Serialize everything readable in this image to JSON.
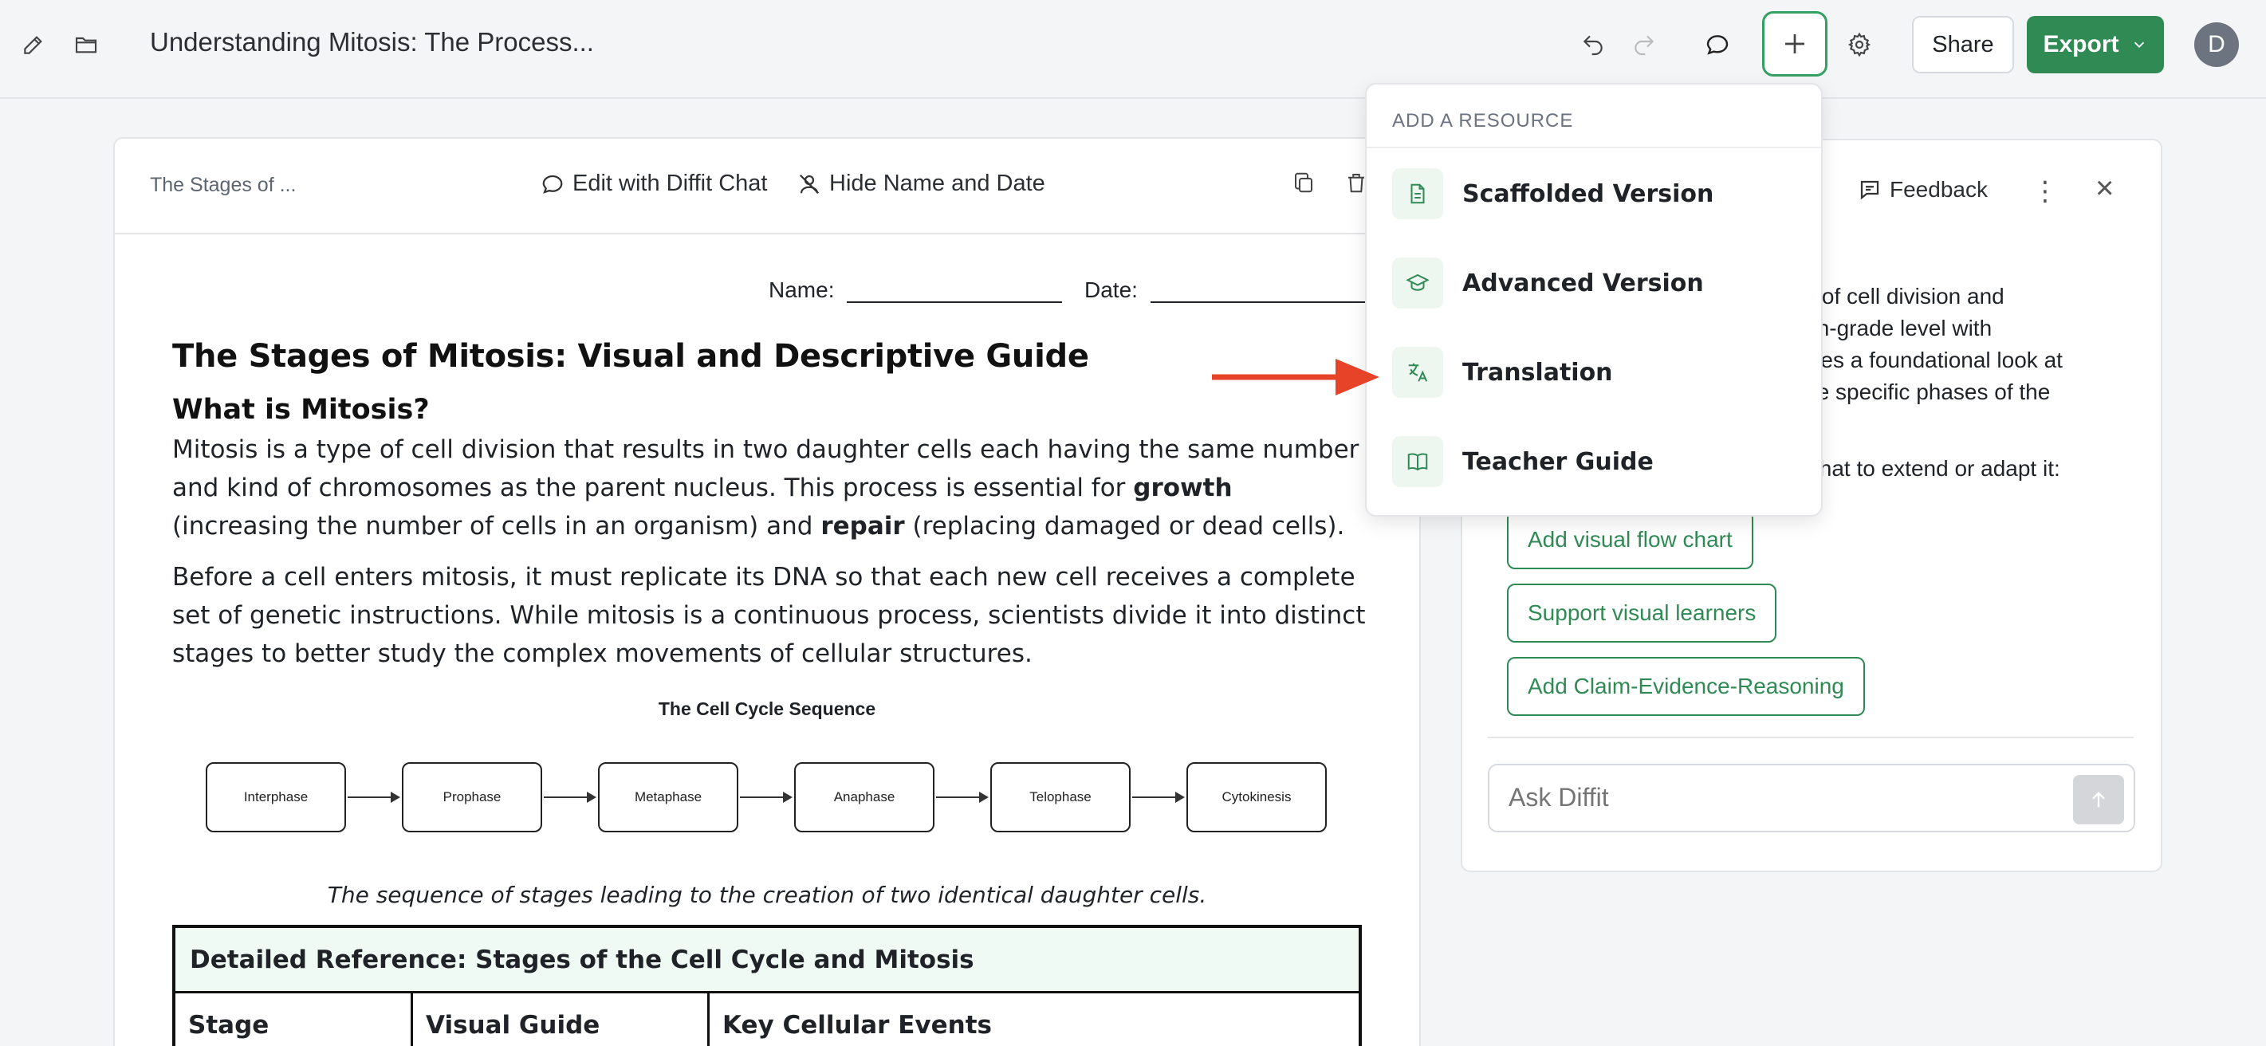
{
  "header": {
    "doc_title": "Understanding Mitosis: The Process...",
    "share_label": "Share",
    "export_label": "Export",
    "avatar_initial": "D"
  },
  "colors": {
    "accent": "#2f8a54",
    "annotation_arrow": "#e64328"
  },
  "document": {
    "breadcrumb": "The Stages of ...",
    "edit_chat_label": "Edit with Diffit Chat",
    "hide_name_label": "Hide Name and Date",
    "name_label": "Name:",
    "date_label": "Date:",
    "title": "The Stages of Mitosis: Visual and Descriptive Guide",
    "section_heading": "What is Mitosis?",
    "para1": {
      "part1": "Mitosis is a type of cell division that results in two daughter cells each having the same number and kind of chromosomes as the parent nucleus. This process is essential for ",
      "bold1": "growth",
      "part2": " (increasing the number of cells in an organism) and ",
      "bold2": "repair",
      "part3": " (replacing damaged or dead cells)."
    },
    "para2": "Before a cell enters mitosis, it must replicate its DNA so that each new cell receives a complete set of genetic instructions. While mitosis is a continuous process, scientists divide it into distinct stages to better study the complex movements of cellular structures.",
    "flow_title": "The Cell Cycle Sequence",
    "flow_stages": [
      "Interphase",
      "Prophase",
      "Metaphase",
      "Anaphase",
      "Telophase",
      "Cytokinesis"
    ],
    "caption": "The sequence of stages leading to the creation of two identical daughter cells.",
    "table": {
      "title": "Detailed Reference: Stages of the Cell Cycle and Mitosis",
      "columns": [
        "Stage",
        "Visual Guide",
        "Key Cellular Events"
      ]
    }
  },
  "side_panel": {
    "feedback_label": "Feedback",
    "text_lines": [
      "ges of cell division and",
      "a 9th-grade level with",
      "ovides a foundational look at",
      "n the specific phases of the"
    ],
    "prompt_line": "fit Chat to extend or adapt it:",
    "chips": [
      "Add visual flow chart",
      "Support visual learners",
      "Add Claim-Evidence-Reasoning"
    ],
    "ask_placeholder": "Ask Diffit"
  },
  "dropdown": {
    "heading": "ADD A RESOURCE",
    "items": [
      {
        "label": "Scaffolded Version",
        "icon": "document-icon"
      },
      {
        "label": "Advanced Version",
        "icon": "graduation-cap-icon"
      },
      {
        "label": "Translation",
        "icon": "translate-icon"
      },
      {
        "label": "Teacher Guide",
        "icon": "book-icon"
      }
    ]
  }
}
